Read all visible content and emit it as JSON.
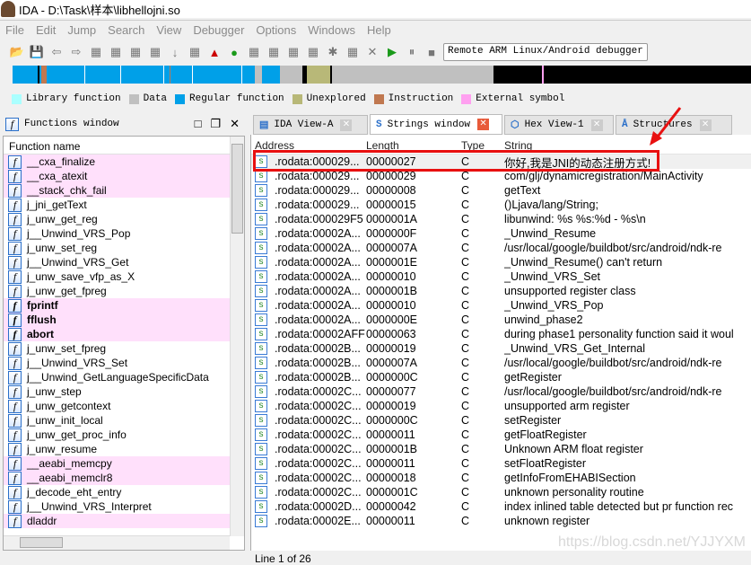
{
  "window": {
    "title": "IDA - D:\\Task\\样本\\libhellojni.so"
  },
  "menu": [
    "File",
    "Edit",
    "Jump",
    "Search",
    "View",
    "Debugger",
    "Options",
    "Windows",
    "Help"
  ],
  "toolbar": {
    "debugger_select": "Remote ARM Linux/Android debugger",
    "icons": [
      "open-icon",
      "save-icon",
      "back-icon",
      "forward-icon",
      "jump-icon",
      "text-icon",
      "hex-icon",
      "script-icon",
      "down-icon",
      "lock-icon",
      "warning-icon",
      "run-green-icon",
      "code-icon",
      "data-icon",
      "string-icon",
      "struct-icon",
      "star-icon",
      "edit-icon",
      "close-icon",
      "play-icon",
      "pause-icon",
      "stop-icon"
    ]
  },
  "legend": [
    {
      "label": "Library function",
      "color": "#aaffff"
    },
    {
      "label": "Data",
      "color": "#c0c0c0"
    },
    {
      "label": "Regular function",
      "color": "#00a0e8"
    },
    {
      "label": "Unexplored",
      "color": "#b8b878"
    },
    {
      "label": "Instruction",
      "color": "#c07850"
    },
    {
      "label": "External symbol",
      "color": "#ffa0f0"
    }
  ],
  "functions_window": {
    "title": "Functions window",
    "column": "Function name",
    "items": [
      {
        "name": "__cxa_finalize",
        "pink": true
      },
      {
        "name": "__cxa_atexit",
        "pink": true
      },
      {
        "name": "__stack_chk_fail",
        "pink": true
      },
      {
        "name": "j_jni_getText"
      },
      {
        "name": "j_unw_get_reg"
      },
      {
        "name": "j__Unwind_VRS_Pop"
      },
      {
        "name": "j_unw_set_reg"
      },
      {
        "name": "j__Unwind_VRS_Get"
      },
      {
        "name": "j_unw_save_vfp_as_X"
      },
      {
        "name": "j_unw_get_fpreg"
      },
      {
        "name": "fprintf",
        "pink": true,
        "bold": true
      },
      {
        "name": "fflush",
        "pink": true,
        "bold": true
      },
      {
        "name": "abort",
        "pink": true,
        "bold": true
      },
      {
        "name": "j_unw_set_fpreg"
      },
      {
        "name": "j__Unwind_VRS_Set"
      },
      {
        "name": "j__Unwind_GetLanguageSpecificData"
      },
      {
        "name": "j_unw_step"
      },
      {
        "name": "j_unw_getcontext"
      },
      {
        "name": "j_unw_init_local"
      },
      {
        "name": "j_unw_get_proc_info"
      },
      {
        "name": "j_unw_resume"
      },
      {
        "name": "__aeabi_memcpy",
        "pink": true
      },
      {
        "name": "__aeabi_memclr8",
        "pink": true
      },
      {
        "name": "j_decode_eht_entry"
      },
      {
        "name": "j__Unwind_VRS_Interpret"
      },
      {
        "name": "dladdr",
        "pink": true
      }
    ]
  },
  "tabs": [
    {
      "label": "IDA View-A"
    },
    {
      "label": "Strings window",
      "active": true
    },
    {
      "label": "Hex View-1"
    },
    {
      "label": "Structures"
    }
  ],
  "strings_window": {
    "columns": [
      "Address",
      "Length",
      "Type",
      "String"
    ],
    "rows": [
      [
        ".rodata:000029...",
        "00000027",
        "C",
        "你好,我是JNI的动态注册方式!"
      ],
      [
        ".rodata:000029...",
        "00000029",
        "C",
        "com/glj/dynamicregistration/MainActivity"
      ],
      [
        ".rodata:000029...",
        "00000008",
        "C",
        "getText"
      ],
      [
        ".rodata:000029...",
        "00000015",
        "C",
        "()Ljava/lang/String;"
      ],
      [
        ".rodata:000029F5",
        "0000001A",
        "C",
        "libunwind: %s %s:%d - %s\\n"
      ],
      [
        ".rodata:00002A...",
        "0000000F",
        "C",
        "_Unwind_Resume"
      ],
      [
        ".rodata:00002A...",
        "0000007A",
        "C",
        "/usr/local/google/buildbot/src/android/ndk-re"
      ],
      [
        ".rodata:00002A...",
        "0000001E",
        "C",
        "_Unwind_Resume() can't return"
      ],
      [
        ".rodata:00002A...",
        "00000010",
        "C",
        "_Unwind_VRS_Set"
      ],
      [
        ".rodata:00002A...",
        "0000001B",
        "C",
        "unsupported register class"
      ],
      [
        ".rodata:00002A...",
        "00000010",
        "C",
        "_Unwind_VRS_Pop"
      ],
      [
        ".rodata:00002A...",
        "0000000E",
        "C",
        "unwind_phase2"
      ],
      [
        ".rodata:00002AFF",
        "00000063",
        "C",
        "during phase1 personality function said it woul"
      ],
      [
        ".rodata:00002B...",
        "00000019",
        "C",
        "_Unwind_VRS_Get_Internal"
      ],
      [
        ".rodata:00002B...",
        "0000007A",
        "C",
        "/usr/local/google/buildbot/src/android/ndk-re"
      ],
      [
        ".rodata:00002B...",
        "0000000C",
        "C",
        "getRegister"
      ],
      [
        ".rodata:00002C...",
        "00000077",
        "C",
        "/usr/local/google/buildbot/src/android/ndk-re"
      ],
      [
        ".rodata:00002C...",
        "00000019",
        "C",
        "unsupported arm register"
      ],
      [
        ".rodata:00002C...",
        "0000000C",
        "C",
        "setRegister"
      ],
      [
        ".rodata:00002C...",
        "00000011",
        "C",
        "getFloatRegister"
      ],
      [
        ".rodata:00002C...",
        "0000001B",
        "C",
        "Unknown ARM float register"
      ],
      [
        ".rodata:00002C...",
        "00000011",
        "C",
        "setFloatRegister"
      ],
      [
        ".rodata:00002C...",
        "00000018",
        "C",
        "getInfoFromEHABISection"
      ],
      [
        ".rodata:00002C...",
        "0000001C",
        "C",
        "unknown personality routine"
      ],
      [
        ".rodata:00002D...",
        "00000042",
        "C",
        "index inlined table detected but pr function rec"
      ],
      [
        ".rodata:00002E...",
        "00000011",
        "C",
        "unknown register"
      ]
    ]
  },
  "status": "Line 1 of 26",
  "watermark": "https://blog.csdn.net/YJJYXM"
}
